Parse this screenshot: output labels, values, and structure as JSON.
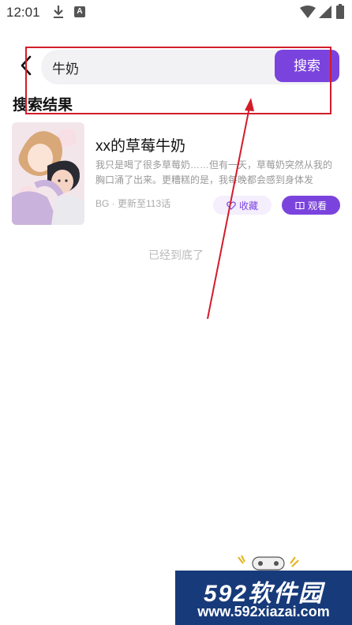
{
  "status_bar": {
    "time": "12:01"
  },
  "search": {
    "value": "牛奶",
    "button_label": "搜索"
  },
  "section": {
    "title": "搜索结果"
  },
  "results": [
    {
      "title": "xx的草莓牛奶",
      "description": "我只是喝了很多草莓奶……但有一天，草莓奶突然从我的胸口涌了出来。更糟糕的是，我每晚都会感到身体发热……",
      "meta": "BG · 更新至113话",
      "collect_label": "收藏",
      "watch_label": "观看"
    }
  ],
  "end_text": "已经到底了",
  "watermark": {
    "logo": "592软件园",
    "url": "www.592xiazai.com"
  },
  "colors": {
    "accent": "#7b43dd",
    "annotation": "#d31c2a",
    "watermark_bg": "#173a7a"
  }
}
